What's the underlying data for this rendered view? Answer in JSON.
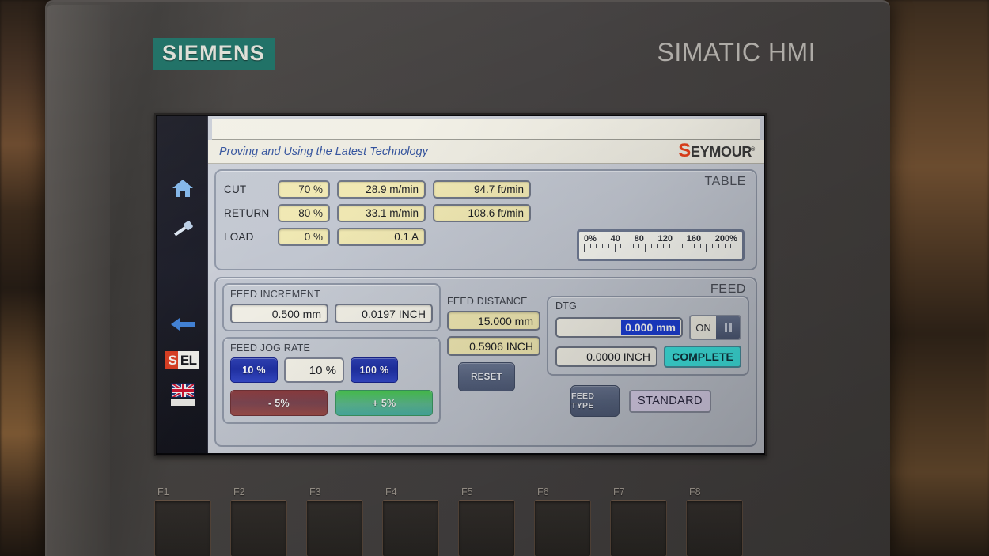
{
  "device": {
    "brand": "SIEMENS",
    "product_line": "SIMATIC HMI",
    "brand_bg": "#1b6e63"
  },
  "screen": {
    "tagline": "Proving and Using the Latest Technology",
    "company_logo": {
      "initial": "S",
      "rest": "EYMOUR",
      "registered": "®",
      "initial_color": "#e8411c"
    },
    "sidebar": {
      "items": [
        {
          "name": "home-icon",
          "label": "Home"
        },
        {
          "name": "tool-icon",
          "label": "Setup"
        },
        {
          "name": "back-arrow-icon",
          "label": "Back"
        },
        {
          "name": "sel-logo",
          "label_s": "S",
          "label_el": "EL"
        },
        {
          "name": "uk-flag-icon",
          "label": "Language"
        }
      ]
    },
    "table_section": {
      "caption": "TABLE",
      "rows": [
        {
          "label": "CUT",
          "percent": "70 %",
          "metric": "28.9 m/min",
          "imperial": "94.7 ft/min"
        },
        {
          "label": "RETURN",
          "percent": "80 %",
          "metric": "33.1 m/min",
          "imperial": "108.6 ft/min"
        },
        {
          "label": "LOAD",
          "percent": "0 %",
          "metric": "0.1 A",
          "imperial": ""
        }
      ],
      "gauge": {
        "ticks": [
          "0%",
          "40",
          "80",
          "120",
          "160",
          "200%"
        ]
      }
    },
    "feed_section": {
      "caption": "FEED",
      "feed_increment": {
        "title": "FEED INCREMENT",
        "mm": "0.500 mm",
        "inch": "0.0197 INCH"
      },
      "feed_jog_rate": {
        "title": "FEED JOG RATE",
        "min_button": "10 %",
        "display": "10 %",
        "max_button": "100 %",
        "decrement_button": "- 5%",
        "increment_button": "+ 5%"
      },
      "feed_distance": {
        "title": "FEED DISTANCE",
        "mm": "15.000 mm",
        "inch": "0.5906 INCH",
        "reset_button": "RESET"
      },
      "dtg": {
        "title": "DTG",
        "mm": "0.000 mm",
        "inch": "0.0000 INCH",
        "toggle_label": "ON",
        "status": "COMPLETE",
        "status_color": "#3fe8e4"
      },
      "feed_type": {
        "button": "FEED TYPE",
        "value": "STANDARD"
      }
    }
  },
  "function_keys": [
    {
      "label": "F1"
    },
    {
      "label": "F2"
    },
    {
      "label": "F3"
    },
    {
      "label": "F4"
    },
    {
      "label": "F5"
    },
    {
      "label": "F6"
    },
    {
      "label": "F7"
    },
    {
      "label": "F8"
    }
  ]
}
